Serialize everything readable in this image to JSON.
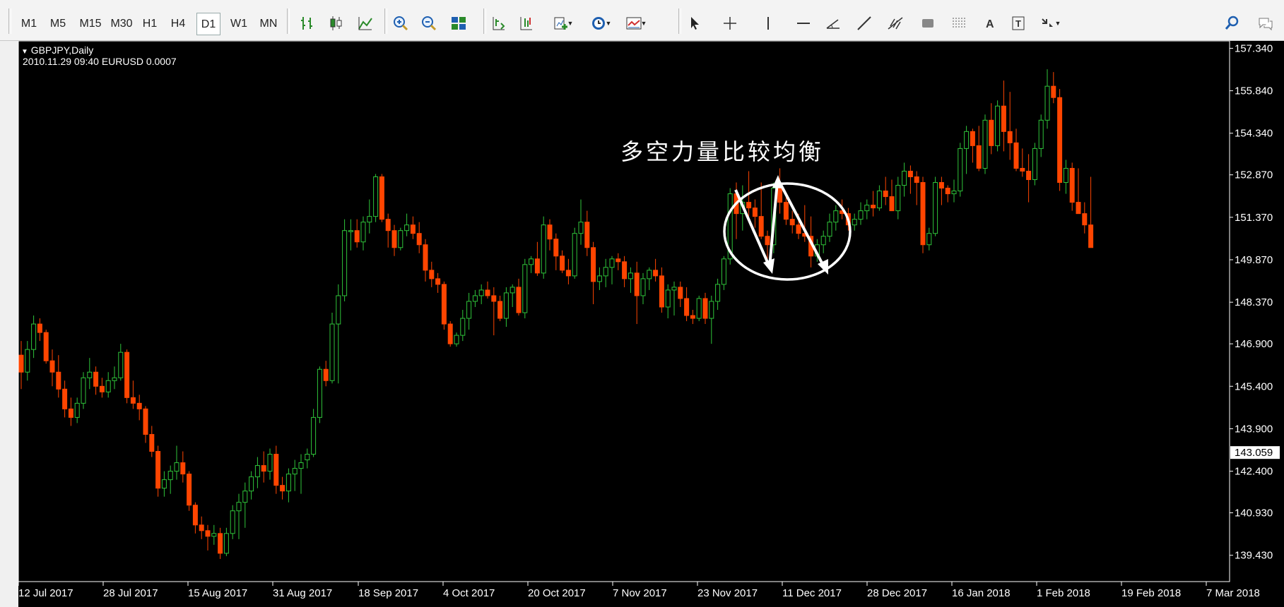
{
  "toolbar": {
    "timeframes": [
      "M1",
      "M5",
      "M15",
      "M30",
      "H1",
      "H4",
      "D1",
      "W1",
      "MN"
    ],
    "active_timeframe": "D1",
    "icons": [
      "bar-chart-icon",
      "candlestick-icon",
      "line-chart-icon",
      "zoom-in-icon",
      "zoom-out-icon",
      "tile-windows-icon",
      "chart-shift-icon",
      "autoscroll-icon",
      "indicators-icon",
      "periods-icon",
      "templates-icon",
      "cursor-icon",
      "crosshair-icon",
      "vertical-line-icon",
      "horizontal-line-icon",
      "trendline-angle-icon",
      "trendline-icon",
      "fibonacci-icon",
      "rectangle-icon",
      "fibonacci-fan-icon",
      "text-icon",
      "text-label-icon",
      "arrows-icon",
      "search-icon",
      "chat-icon"
    ]
  },
  "chart_header": {
    "symbol": "GBPJPY,Daily",
    "crosshair_info": "2010.11.29 09:40 EURUSD 0.0007"
  },
  "annotation": {
    "text": "多空力量比较均衡"
  },
  "colors": {
    "background": "#000000",
    "bull": "#2fc43a",
    "bear": "#ff4500",
    "axis": "#ffffff",
    "annotation": "#ffffff"
  },
  "chart_data": {
    "type": "candlestick",
    "symbol": "GBPJPY",
    "timeframe": "Daily",
    "ylim": [
      138.5,
      157.6
    ],
    "y_ticks": [
      "157.340",
      "155.840",
      "154.340",
      "152.870",
      "151.370",
      "149.870",
      "148.370",
      "146.900",
      "145.400",
      "143.900",
      "142.400",
      "140.930",
      "139.430"
    ],
    "current_price": "143.059",
    "x_labels": [
      "12 Jul 2017",
      "28 Jul 2017",
      "15 Aug 2017",
      "31 Aug 2017",
      "18 Sep 2017",
      "4 Oct 2017",
      "20 Oct 2017",
      "7 Nov 2017",
      "23 Nov 2017",
      "11 Dec 2017",
      "28 Dec 2017",
      "16 Jan 2018",
      "1 Feb 2018",
      "19 Feb 2018",
      "7 Mar 2018"
    ],
    "candles": [
      [
        146.5,
        147.0,
        145.3,
        145.9
      ],
      [
        145.9,
        147.0,
        145.6,
        146.7
      ],
      [
        146.7,
        147.9,
        146.4,
        147.6
      ],
      [
        147.6,
        147.8,
        147.0,
        147.3
      ],
      [
        147.3,
        147.4,
        146.2,
        146.3
      ],
      [
        146.3,
        146.7,
        145.4,
        145.9
      ],
      [
        145.9,
        146.5,
        145.0,
        145.3
      ],
      [
        145.3,
        145.6,
        144.3,
        144.6
      ],
      [
        144.6,
        145.0,
        144.0,
        144.3
      ],
      [
        144.3,
        145.0,
        144.1,
        144.8
      ],
      [
        144.8,
        145.9,
        144.6,
        145.7
      ],
      [
        145.7,
        146.4,
        145.3,
        145.9
      ],
      [
        145.9,
        146.1,
        145.1,
        145.4
      ],
      [
        145.4,
        145.7,
        145.0,
        145.2
      ],
      [
        145.2,
        145.9,
        145.0,
        145.6
      ],
      [
        145.6,
        146.1,
        145.3,
        145.7
      ],
      [
        145.7,
        146.9,
        145.6,
        146.6
      ],
      [
        146.6,
        146.7,
        144.8,
        145.0
      ],
      [
        145.0,
        145.6,
        144.6,
        144.8
      ],
      [
        144.8,
        145.1,
        144.2,
        144.6
      ],
      [
        144.6,
        144.7,
        143.4,
        143.7
      ],
      [
        143.7,
        144.0,
        142.9,
        143.1
      ],
      [
        143.1,
        143.3,
        141.5,
        141.8
      ],
      [
        141.8,
        142.4,
        141.5,
        142.1
      ],
      [
        142.1,
        142.6,
        141.6,
        142.4
      ],
      [
        142.4,
        143.3,
        142.1,
        142.7
      ],
      [
        142.7,
        143.1,
        142.0,
        142.3
      ],
      [
        142.3,
        142.4,
        141.0,
        141.2
      ],
      [
        141.2,
        141.3,
        140.2,
        140.5
      ],
      [
        140.5,
        140.8,
        140.0,
        140.3
      ],
      [
        140.3,
        140.5,
        139.6,
        140.1
      ],
      [
        140.1,
        140.5,
        139.8,
        140.2
      ],
      [
        140.2,
        140.4,
        139.3,
        139.5
      ],
      [
        139.5,
        140.4,
        139.4,
        140.2
      ],
      [
        140.2,
        141.2,
        140.0,
        141.0
      ],
      [
        141.0,
        141.6,
        140.0,
        141.3
      ],
      [
        141.3,
        142.0,
        140.4,
        141.7
      ],
      [
        141.7,
        142.4,
        141.4,
        142.2
      ],
      [
        142.2,
        142.9,
        141.8,
        142.6
      ],
      [
        142.6,
        143.1,
        142.0,
        142.4
      ],
      [
        142.4,
        143.2,
        142.1,
        143.0
      ],
      [
        143.0,
        143.3,
        141.6,
        141.9
      ],
      [
        141.9,
        142.2,
        141.4,
        141.7
      ],
      [
        141.7,
        142.5,
        141.3,
        142.3
      ],
      [
        142.3,
        142.8,
        141.7,
        142.5
      ],
      [
        142.5,
        143.0,
        141.6,
        142.7
      ],
      [
        142.8,
        143.2,
        142.5,
        143.0
      ],
      [
        143.0,
        144.6,
        142.9,
        144.3
      ],
      [
        144.3,
        146.1,
        144.1,
        146.0
      ],
      [
        146.0,
        146.3,
        145.4,
        145.6
      ],
      [
        145.6,
        148.0,
        145.5,
        147.6
      ],
      [
        147.6,
        149.0,
        145.5,
        148.6
      ],
      [
        148.6,
        151.3,
        148.4,
        150.9
      ],
      [
        150.9,
        151.3,
        150.2,
        150.9
      ],
      [
        150.9,
        151.3,
        150.3,
        150.5
      ],
      [
        150.5,
        151.4,
        150.2,
        151.2
      ],
      [
        151.2,
        152.0,
        150.8,
        151.4
      ],
      [
        151.4,
        152.9,
        151.2,
        152.8
      ],
      [
        152.8,
        152.9,
        151.2,
        151.3
      ],
      [
        151.3,
        151.5,
        150.3,
        150.9
      ],
      [
        150.9,
        151.1,
        150.0,
        150.3
      ],
      [
        150.3,
        151.0,
        150.2,
        150.9
      ],
      [
        150.9,
        151.5,
        150.7,
        151.1
      ],
      [
        151.1,
        151.4,
        150.6,
        150.8
      ],
      [
        150.8,
        151.2,
        150.1,
        150.4
      ],
      [
        150.4,
        150.6,
        149.1,
        149.5
      ],
      [
        149.5,
        149.8,
        148.9,
        149.2
      ],
      [
        149.2,
        149.4,
        148.7,
        149.0
      ],
      [
        149.0,
        149.1,
        147.4,
        147.6
      ],
      [
        147.6,
        147.7,
        146.8,
        146.9
      ],
      [
        146.9,
        147.3,
        146.8,
        147.2
      ],
      [
        147.2,
        148.1,
        147.0,
        147.8
      ],
      [
        147.8,
        148.7,
        147.4,
        148.4
      ],
      [
        148.4,
        148.8,
        148.2,
        148.6
      ],
      [
        148.6,
        149.0,
        148.3,
        148.8
      ],
      [
        148.8,
        149.1,
        148.5,
        148.6
      ],
      [
        148.6,
        148.9,
        147.2,
        148.4
      ],
      [
        148.4,
        148.6,
        147.7,
        147.8
      ],
      [
        147.8,
        148.9,
        147.5,
        148.7
      ],
      [
        148.7,
        149.0,
        148.2,
        148.9
      ],
      [
        148.9,
        149.2,
        147.9,
        148.0
      ],
      [
        148.0,
        149.9,
        147.8,
        149.7
      ],
      [
        149.7,
        150.0,
        149.4,
        149.9
      ],
      [
        149.9,
        150.5,
        149.3,
        149.4
      ],
      [
        149.4,
        151.4,
        149.2,
        151.1
      ],
      [
        151.1,
        151.3,
        150.2,
        150.6
      ],
      [
        150.6,
        150.8,
        149.5,
        150.0
      ],
      [
        150.0,
        150.2,
        149.4,
        149.5
      ],
      [
        149.5,
        149.9,
        149.0,
        149.3
      ],
      [
        149.3,
        151.0,
        149.2,
        150.8
      ],
      [
        150.8,
        152.0,
        150.4,
        151.2
      ],
      [
        151.2,
        151.6,
        150.0,
        150.3
      ],
      [
        150.3,
        150.5,
        148.3,
        149.1
      ],
      [
        149.1,
        149.6,
        148.8,
        149.3
      ],
      [
        149.3,
        149.9,
        148.9,
        149.6
      ],
      [
        149.6,
        150.0,
        149.0,
        149.9
      ],
      [
        149.9,
        150.1,
        149.5,
        149.8
      ],
      [
        149.8,
        150.0,
        148.9,
        149.2
      ],
      [
        149.2,
        149.6,
        148.7,
        149.4
      ],
      [
        149.4,
        149.8,
        147.6,
        148.6
      ],
      [
        148.6,
        149.4,
        148.3,
        149.2
      ],
      [
        149.2,
        149.6,
        148.8,
        149.5
      ],
      [
        149.5,
        149.9,
        149.1,
        149.3
      ],
      [
        149.3,
        149.6,
        148.0,
        148.2
      ],
      [
        148.2,
        149.0,
        147.8,
        148.8
      ],
      [
        148.8,
        149.1,
        147.9,
        148.9
      ],
      [
        148.9,
        149.1,
        148.2,
        148.5
      ],
      [
        148.5,
        148.9,
        147.7,
        147.9
      ],
      [
        147.9,
        148.1,
        147.6,
        147.8
      ],
      [
        147.8,
        148.6,
        147.7,
        148.5
      ],
      [
        148.5,
        148.7,
        147.6,
        147.8
      ],
      [
        147.8,
        148.6,
        146.9,
        148.4
      ],
      [
        148.4,
        149.2,
        148.1,
        149.0
      ],
      [
        149.0,
        150.0,
        148.8,
        149.9
      ],
      [
        149.9,
        152.4,
        149.7,
        152.2
      ],
      [
        152.2,
        152.6,
        150.6,
        151.5
      ],
      [
        151.5,
        152.5,
        150.9,
        151.9
      ],
      [
        151.9,
        153.0,
        151.4,
        151.7
      ],
      [
        151.7,
        152.0,
        151.0,
        151.4
      ],
      [
        151.4,
        152.6,
        150.6,
        150.7
      ],
      [
        150.7,
        150.9,
        149.9,
        150.4
      ],
      [
        150.4,
        152.6,
        150.1,
        152.4
      ],
      [
        152.4,
        153.1,
        151.5,
        151.9
      ],
      [
        151.9,
        152.2,
        151.1,
        151.3
      ],
      [
        151.3,
        151.6,
        150.8,
        151.1
      ],
      [
        151.1,
        151.5,
        150.6,
        150.8
      ],
      [
        150.8,
        151.8,
        150.5,
        150.7
      ],
      [
        150.7,
        151.4,
        149.6,
        150.0
      ],
      [
        150.0,
        150.6,
        149.8,
        150.4
      ],
      [
        150.4,
        150.9,
        150.1,
        150.7
      ],
      [
        150.7,
        151.5,
        150.5,
        151.2
      ],
      [
        151.2,
        151.8,
        150.9,
        151.6
      ],
      [
        151.6,
        152.0,
        151.3,
        151.5
      ],
      [
        151.5,
        151.7,
        150.9,
        151.1
      ],
      [
        151.1,
        151.5,
        150.9,
        151.3
      ],
      [
        151.3,
        151.9,
        151.1,
        151.6
      ],
      [
        151.6,
        152.0,
        151.3,
        151.8
      ],
      [
        151.8,
        152.3,
        151.4,
        151.7
      ],
      [
        151.7,
        152.5,
        151.6,
        152.3
      ],
      [
        152.3,
        152.8,
        151.8,
        152.1
      ],
      [
        152.1,
        152.7,
        151.6,
        151.6
      ],
      [
        151.6,
        152.8,
        151.3,
        152.5
      ],
      [
        152.5,
        153.3,
        152.1,
        153.0
      ],
      [
        153.0,
        153.2,
        152.2,
        152.8
      ],
      [
        152.8,
        153.0,
        151.8,
        152.6
      ],
      [
        152.6,
        152.8,
        150.1,
        150.4
      ],
      [
        150.4,
        151.0,
        150.2,
        150.8
      ],
      [
        150.8,
        152.8,
        150.7,
        152.6
      ],
      [
        152.6,
        152.8,
        151.8,
        152.4
      ],
      [
        152.4,
        152.5,
        151.9,
        152.2
      ],
      [
        152.2,
        152.7,
        151.9,
        152.3
      ],
      [
        152.3,
        154.0,
        152.1,
        153.8
      ],
      [
        153.8,
        154.6,
        152.9,
        154.4
      ],
      [
        154.4,
        154.5,
        153.3,
        153.9
      ],
      [
        153.9,
        154.6,
        153.0,
        153.1
      ],
      [
        153.1,
        155.0,
        152.9,
        154.8
      ],
      [
        154.8,
        155.4,
        153.6,
        153.9
      ],
      [
        153.9,
        155.5,
        153.7,
        155.3
      ],
      [
        155.3,
        156.2,
        153.7,
        154.4
      ],
      [
        154.4,
        155.8,
        153.4,
        154.0
      ],
      [
        154.0,
        154.5,
        153.0,
        153.1
      ],
      [
        153.1,
        153.8,
        152.8,
        153.0
      ],
      [
        153.0,
        153.6,
        151.9,
        152.7
      ],
      [
        152.7,
        154.0,
        152.5,
        153.8
      ],
      [
        153.8,
        155.0,
        153.5,
        154.8
      ],
      [
        154.8,
        156.6,
        154.5,
        156.0
      ],
      [
        156.0,
        156.5,
        155.4,
        155.6
      ],
      [
        155.6,
        155.9,
        152.3,
        152.6
      ],
      [
        152.6,
        153.4,
        152.2,
        153.1
      ],
      [
        153.1,
        153.3,
        151.6,
        151.9
      ],
      [
        151.9,
        153.1,
        151.5,
        151.5
      ],
      [
        151.5,
        151.9,
        150.8,
        151.1
      ],
      [
        151.1,
        152.8,
        150.3,
        150.3
      ]
    ]
  }
}
